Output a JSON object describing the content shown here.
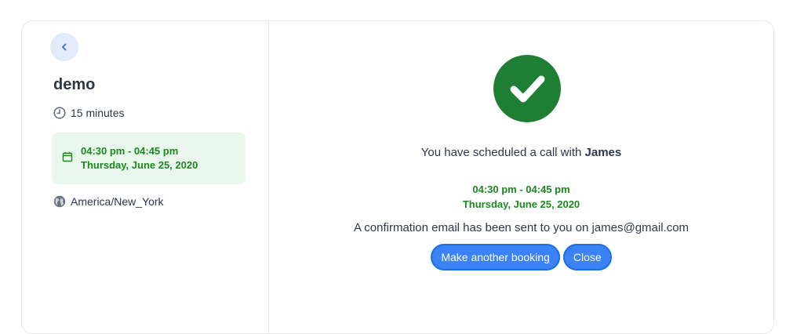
{
  "event": {
    "title": "demo",
    "duration": "15 minutes",
    "slot_time": "04:30 pm - 04:45 pm",
    "slot_date": "Thursday, June 25, 2020",
    "timezone": "America/New_York"
  },
  "icons": {
    "back": "chevron-left-icon",
    "clock": "clock-icon",
    "calendar": "calendar-icon",
    "globe": "globe-icon",
    "success": "check-icon"
  },
  "confirmation": {
    "message_prefix": "You have scheduled a call with ",
    "host_name": "James",
    "slot_time": "04:30 pm - 04:45 pm",
    "slot_date": "Thursday, June 25, 2020",
    "email_message": "A confirmation email has been sent to you on james@gmail.com"
  },
  "actions": {
    "another_booking_label": "Make another booking",
    "close_label": "Close"
  },
  "colors": {
    "accent": "#3b82f6",
    "success": "#1e7e34",
    "slot_text": "#1a8a1e",
    "slot_bg": "#e9f7ec"
  }
}
